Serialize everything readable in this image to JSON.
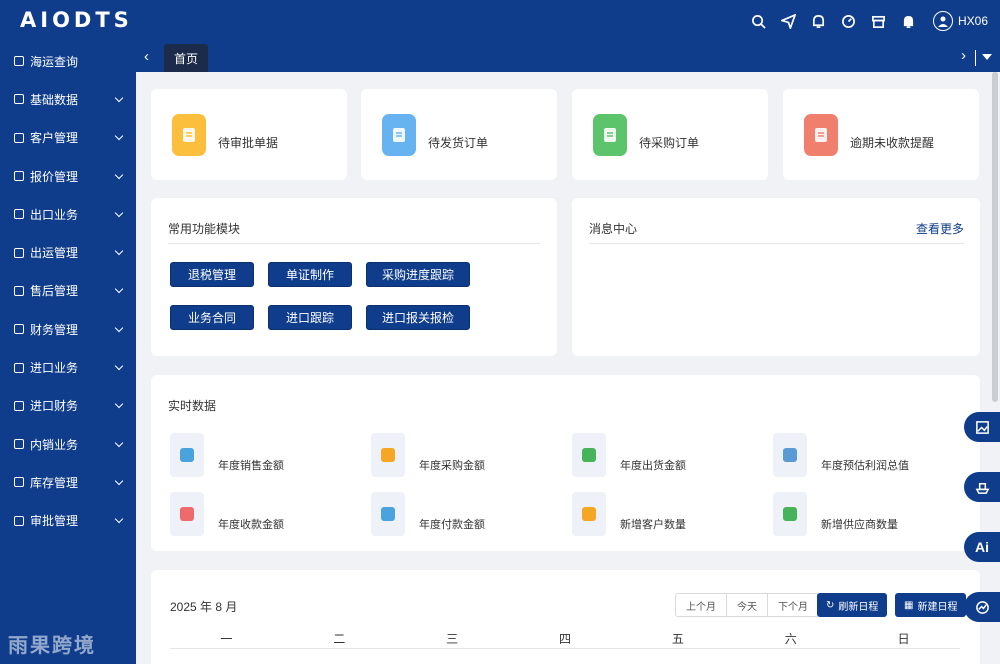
{
  "app": {
    "logo": "AIODTS",
    "username": "HX06"
  },
  "header_icons": [
    "search-icon",
    "send-icon",
    "bell-icon",
    "gauge-icon",
    "shop-icon",
    "notification-icon"
  ],
  "sidebar": {
    "items": [
      {
        "label": "海运查询",
        "has_children": false
      },
      {
        "label": "基础数据",
        "has_children": true
      },
      {
        "label": "客户管理",
        "has_children": true
      },
      {
        "label": "报价管理",
        "has_children": true
      },
      {
        "label": "出口业务",
        "has_children": true
      },
      {
        "label": "出运管理",
        "has_children": true
      },
      {
        "label": "售后管理",
        "has_children": true
      },
      {
        "label": "财务管理",
        "has_children": true
      },
      {
        "label": "进口业务",
        "has_children": true
      },
      {
        "label": "进口财务",
        "has_children": true
      },
      {
        "label": "内销业务",
        "has_children": true
      },
      {
        "label": "库存管理",
        "has_children": true
      },
      {
        "label": "审批管理",
        "has_children": true
      }
    ],
    "footer_text": "雨果跨境"
  },
  "tabs": {
    "home": "首页"
  },
  "stat_cards": [
    {
      "label": "待审批单据",
      "color": "#fbbf3d"
    },
    {
      "label": "待发货订单",
      "color": "#67b3f2"
    },
    {
      "label": "待采购订单",
      "color": "#5cc46b"
    },
    {
      "label": "逾期未收款提醒",
      "color": "#f07f6e"
    }
  ],
  "common_functions": {
    "title": "常用功能模块",
    "buttons": [
      "退税管理",
      "单证制作",
      "采购进度跟踪",
      "业务合同",
      "进口跟踪",
      "进口报关报检"
    ]
  },
  "messages": {
    "title": "消息中心",
    "more": "查看更多"
  },
  "realtime": {
    "title": "实时数据",
    "items": [
      {
        "label": "年度销售金额",
        "color": "#4aa3df"
      },
      {
        "label": "年度采购金额",
        "color": "#f5a623"
      },
      {
        "label": "年度出货金额",
        "color": "#47b35a"
      },
      {
        "label": "年度预估利润总值",
        "color": "#5b9bd5"
      },
      {
        "label": "年度收款金额",
        "color": "#ef6b6b"
      },
      {
        "label": "年度付款金额",
        "color": "#4aa3df"
      },
      {
        "label": "新增客户数量",
        "color": "#f5a623"
      },
      {
        "label": "新增供应商数量",
        "color": "#47b35a"
      }
    ]
  },
  "calendar": {
    "title": "2025 年 8 月",
    "prev": "上个月",
    "today": "今天",
    "next": "下个月",
    "refresh": "刷新日程",
    "new": "新建日程",
    "weekdays": [
      "一",
      "二",
      "三",
      "四",
      "五",
      "六",
      "日"
    ]
  },
  "float_buttons": {
    "ai": "Ai"
  }
}
